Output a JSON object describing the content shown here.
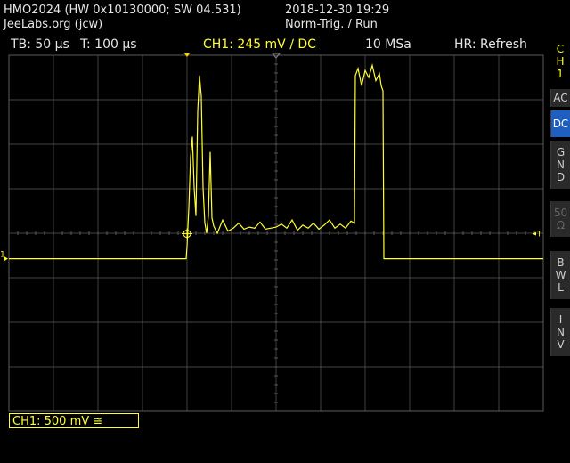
{
  "header": {
    "device": "HMO2024 (HW 0x10130000; SW 04.531)",
    "owner": "JeeLabs.org (jcw)",
    "datetime": "2018-12-30 19:29",
    "trigger_mode": "Norm-Trig. / Run"
  },
  "status": {
    "timebase": "TB: 50 µs",
    "trigger_time": "T: 100 µs",
    "channel": "CH1: 245 mV ∕ DC",
    "sample_rate": "10 MSa",
    "hr": "HR: Refresh"
  },
  "sidebar": {
    "channel_label": [
      "C",
      "H",
      "1"
    ],
    "buttons": [
      {
        "label": [
          "AC"
        ],
        "state": "normal"
      },
      {
        "label": [
          "DC"
        ],
        "state": "active"
      },
      {
        "label": [
          "G",
          "N",
          "D"
        ],
        "state": "normal"
      },
      {
        "label": [
          "50",
          "Ω"
        ],
        "state": "dim"
      },
      {
        "label": [
          "B",
          "W",
          "L"
        ],
        "state": "normal"
      },
      {
        "label": [
          "I",
          "N",
          "V"
        ],
        "state": "normal"
      }
    ]
  },
  "markers": {
    "ground": "1",
    "trigger_level": "T"
  },
  "scale_box": "CH1: 500 mV ≅",
  "colors": {
    "trace": "#ffff33",
    "grid": "#5a5a5a",
    "active_button": "#1f5fbf"
  },
  "chart_data": {
    "type": "line",
    "x_unit": "µs",
    "y_unit": "mV",
    "x_per_div": 50,
    "y_per_div": 500,
    "x_range": [
      -200,
      400
    ],
    "y_range": [
      -1500,
      2000
    ],
    "x": [
      -200,
      -125,
      -50,
      -1,
      0,
      2,
      4,
      6,
      8,
      10,
      12,
      14,
      16,
      18,
      20,
      22,
      24,
      26,
      28,
      30,
      34,
      40,
      46,
      52,
      58,
      64,
      70,
      76,
      82,
      88,
      94,
      100,
      106,
      112,
      118,
      124,
      130,
      136,
      142,
      148,
      154,
      160,
      166,
      172,
      178,
      184,
      188,
      189,
      192,
      196,
      200,
      204,
      208,
      212,
      216,
      218,
      220,
      221,
      224,
      230,
      240,
      300,
      350,
      400
    ],
    "values": [
      0,
      0,
      0,
      0,
      120,
      500,
      1000,
      1200,
      700,
      420,
      1450,
      1800,
      1600,
      700,
      350,
      250,
      420,
      1050,
      400,
      320,
      250,
      380,
      270,
      300,
      350,
      290,
      310,
      300,
      360,
      290,
      300,
      310,
      340,
      300,
      380,
      280,
      330,
      300,
      350,
      290,
      330,
      380,
      300,
      340,
      300,
      370,
      350,
      1800,
      1870,
      1700,
      1850,
      1780,
      1900,
      1750,
      1820,
      1700,
      1650,
      0,
      0,
      0,
      0,
      0,
      0,
      0
    ]
  }
}
